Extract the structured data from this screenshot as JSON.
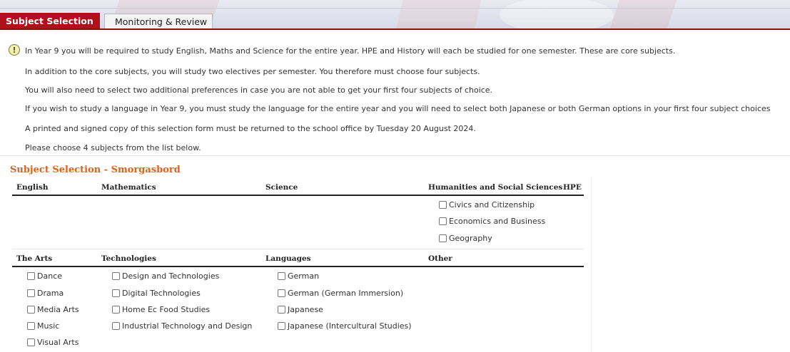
{
  "tabs": {
    "active": "Subject Selection",
    "inactive": "Monitoring & Review"
  },
  "info_icon": "info-exclamation-icon",
  "instructions": [
    "In Year 9 you will be required to study English, Maths and Science for the entire year. HPE and History will each be studied for one semester. These are core subjects.",
    "In addition to the core subjects, you will study two electives per semester. You therefore must choose four subjects.",
    "You will also need to select two additional preferences in case you are not able to get your first four subjects of choice.",
    "If you wish to study a language in Year 9, you must study the language for the entire year and you will need to select both Japanese or both German options in your first four subject choices",
    "A printed and signed copy of this selection form must be returned to the school office by Tuesday 20 August 2024.",
    "Please choose 4 subjects from the list below."
  ],
  "section_title": "Subject Selection - Smorgasbord",
  "group1": {
    "headers": [
      "English",
      "Mathematics",
      "Science",
      "Humanities and Social Sciences",
      "HPE"
    ],
    "humanities_options": [
      "Civics and Citizenship",
      "Economics and Business",
      "Geography"
    ]
  },
  "group2": {
    "headers": [
      "The Arts",
      "Technologies",
      "Languages",
      "Other"
    ],
    "arts_options": [
      "Dance",
      "Drama",
      "Media Arts",
      "Music",
      "Visual Arts"
    ],
    "tech_options": [
      "Design and Technologies",
      "Digital Technologies",
      "Home Ec Food Studies",
      "Industrial Technology and Design"
    ],
    "language_options": [
      "German",
      "German (German Immersion)",
      "Japanese",
      "Japanese (Intercultural Studies)"
    ]
  },
  "colors": {
    "active_tab": "#b0101a",
    "section_title": "#e0601a"
  }
}
